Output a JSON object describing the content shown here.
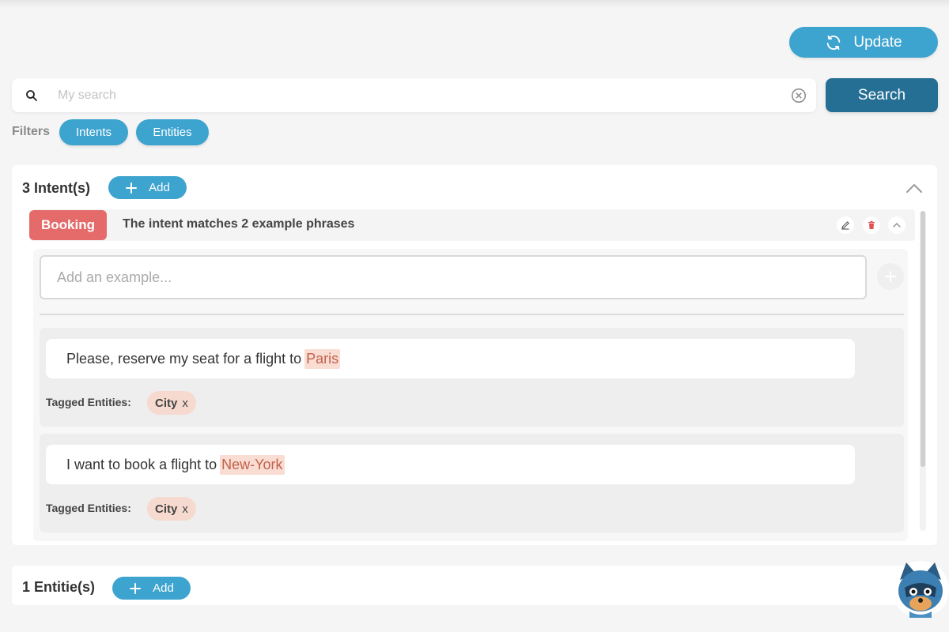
{
  "header": {
    "update_label": "Update"
  },
  "search": {
    "placeholder": "My search",
    "button_label": "Search"
  },
  "filters": {
    "label": "Filters",
    "options": [
      "Intents",
      "Entities"
    ]
  },
  "intents_section": {
    "title": "3 Intent(s)",
    "add_label": "Add",
    "intent": {
      "name": "Booking",
      "description": "The intent matches 2 example phrases",
      "example_placeholder": "Add an example...",
      "phrases": [
        {
          "text_before": "Please, reserve my seat for a flight to",
          "entity_value": "Paris",
          "tagged_label": "Tagged Entities:",
          "tag": "City",
          "tag_remove": "x"
        },
        {
          "text_before": "I want to book a flight to",
          "entity_value": "New-York",
          "tagged_label": "Tagged Entities:",
          "tag": "City",
          "tag_remove": "x"
        }
      ]
    }
  },
  "entities_section": {
    "title": "1 Entitie(s)",
    "add_label": "Add"
  },
  "colors": {
    "accent": "#3da3cf",
    "search_button": "#266f94",
    "intent_badge": "#e56a6a",
    "entity_highlight": "#f9ddd3"
  },
  "icons": {
    "update": "refresh-icon",
    "search": "magnifier-icon",
    "clear": "circle-x-icon",
    "add": "plus-icon",
    "collapse": "chevron-up-icon",
    "edit": "pencil-icon",
    "delete": "trash-icon"
  }
}
